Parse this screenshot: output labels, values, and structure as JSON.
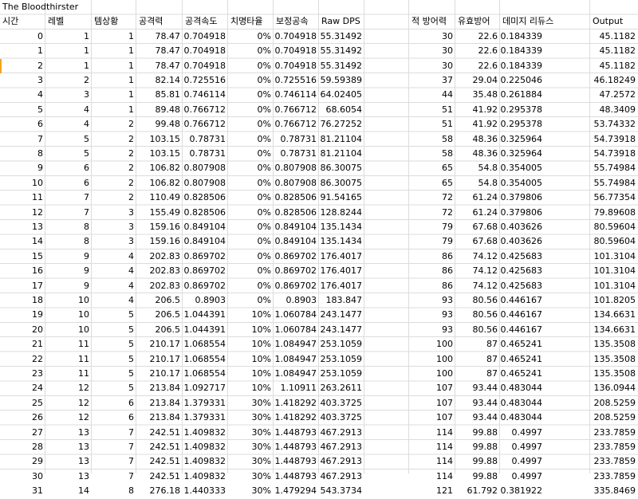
{
  "title": "The Bloodthirster",
  "headers": [
    "시간",
    "레벨",
    "템상황",
    "공격력",
    "공격속도",
    "치명타율",
    "보정공속",
    "Raw DPS",
    "",
    "적 방어력",
    "유효방어",
    "데미지 리듀스",
    "",
    "Output"
  ],
  "rows": [
    [
      "0",
      "1",
      "1",
      "78.47",
      "0.704918",
      "0%",
      "0.704918",
      "55.31492",
      "",
      "30",
      "22.6",
      "0.184339",
      "",
      "45.1182"
    ],
    [
      "1",
      "1",
      "1",
      "78.47",
      "0.704918",
      "0%",
      "0.704918",
      "55.31492",
      "",
      "30",
      "22.6",
      "0.184339",
      "",
      "45.1182"
    ],
    [
      "2",
      "1",
      "1",
      "78.47",
      "0.704918",
      "0%",
      "0.704918",
      "55.31492",
      "",
      "30",
      "22.6",
      "0.184339",
      "",
      "45.1182"
    ],
    [
      "3",
      "2",
      "1",
      "82.14",
      "0.725516",
      "0%",
      "0.725516",
      "59.59389",
      "",
      "37",
      "29.04",
      "0.225046",
      "",
      "46.18249"
    ],
    [
      "4",
      "3",
      "1",
      "85.81",
      "0.746114",
      "0%",
      "0.746114",
      "64.02405",
      "",
      "44",
      "35.48",
      "0.261884",
      "",
      "47.2572"
    ],
    [
      "5",
      "4",
      "1",
      "89.48",
      "0.766712",
      "0%",
      "0.766712",
      "68.6054",
      "",
      "51",
      "41.92",
      "0.295378",
      "",
      "48.3409"
    ],
    [
      "6",
      "4",
      "2",
      "99.48",
      "0.766712",
      "0%",
      "0.766712",
      "76.27252",
      "",
      "51",
      "41.92",
      "0.295378",
      "",
      "53.74332"
    ],
    [
      "7",
      "5",
      "2",
      "103.15",
      "0.78731",
      "0%",
      "0.78731",
      "81.21104",
      "",
      "58",
      "48.36",
      "0.325964",
      "",
      "54.73918"
    ],
    [
      "8",
      "5",
      "2",
      "103.15",
      "0.78731",
      "0%",
      "0.78731",
      "81.21104",
      "",
      "58",
      "48.36",
      "0.325964",
      "",
      "54.73918"
    ],
    [
      "9",
      "6",
      "2",
      "106.82",
      "0.807908",
      "0%",
      "0.807908",
      "86.30075",
      "",
      "65",
      "54.8",
      "0.354005",
      "",
      "55.74984"
    ],
    [
      "10",
      "6",
      "2",
      "106.82",
      "0.807908",
      "0%",
      "0.807908",
      "86.30075",
      "",
      "65",
      "54.8",
      "0.354005",
      "",
      "55.74984"
    ],
    [
      "11",
      "7",
      "2",
      "110.49",
      "0.828506",
      "0%",
      "0.828506",
      "91.54165",
      "",
      "72",
      "61.24",
      "0.379806",
      "",
      "56.77354"
    ],
    [
      "12",
      "7",
      "3",
      "155.49",
      "0.828506",
      "0%",
      "0.828506",
      "128.8244",
      "",
      "72",
      "61.24",
      "0.379806",
      "",
      "79.89608"
    ],
    [
      "13",
      "8",
      "3",
      "159.16",
      "0.849104",
      "0%",
      "0.849104",
      "135.1434",
      "",
      "79",
      "67.68",
      "0.403626",
      "",
      "80.59604"
    ],
    [
      "14",
      "8",
      "3",
      "159.16",
      "0.849104",
      "0%",
      "0.849104",
      "135.1434",
      "",
      "79",
      "67.68",
      "0.403626",
      "",
      "80.59604"
    ],
    [
      "15",
      "9",
      "4",
      "202.83",
      "0.869702",
      "0%",
      "0.869702",
      "176.4017",
      "",
      "86",
      "74.12",
      "0.425683",
      "",
      "101.3104"
    ],
    [
      "16",
      "9",
      "4",
      "202.83",
      "0.869702",
      "0%",
      "0.869702",
      "176.4017",
      "",
      "86",
      "74.12",
      "0.425683",
      "",
      "101.3104"
    ],
    [
      "17",
      "9",
      "4",
      "202.83",
      "0.869702",
      "0%",
      "0.869702",
      "176.4017",
      "",
      "86",
      "74.12",
      "0.425683",
      "",
      "101.3104"
    ],
    [
      "18",
      "10",
      "4",
      "206.5",
      "0.8903",
      "0%",
      "0.8903",
      "183.847",
      "",
      "93",
      "80.56",
      "0.446167",
      "",
      "101.8205"
    ],
    [
      "19",
      "10",
      "5",
      "206.5",
      "1.044391",
      "10%",
      "1.060784",
      "243.1477",
      "",
      "93",
      "80.56",
      "0.446167",
      "",
      "134.6631"
    ],
    [
      "20",
      "10",
      "5",
      "206.5",
      "1.044391",
      "10%",
      "1.060784",
      "243.1477",
      "",
      "93",
      "80.56",
      "0.446167",
      "",
      "134.6631"
    ],
    [
      "21",
      "11",
      "5",
      "210.17",
      "1.068554",
      "10%",
      "1.084947",
      "253.1059",
      "",
      "100",
      "87",
      "0.465241",
      "",
      "135.3508"
    ],
    [
      "22",
      "11",
      "5",
      "210.17",
      "1.068554",
      "10%",
      "1.084947",
      "253.1059",
      "",
      "100",
      "87",
      "0.465241",
      "",
      "135.3508"
    ],
    [
      "23",
      "11",
      "5",
      "210.17",
      "1.068554",
      "10%",
      "1.084947",
      "253.1059",
      "",
      "100",
      "87",
      "0.465241",
      "",
      "135.3508"
    ],
    [
      "24",
      "12",
      "5",
      "213.84",
      "1.092717",
      "10%",
      "1.10911",
      "263.2611",
      "",
      "107",
      "93.44",
      "0.483044",
      "",
      "136.0944"
    ],
    [
      "25",
      "12",
      "6",
      "213.84",
      "1.379331",
      "30%",
      "1.418292",
      "403.3725",
      "",
      "107",
      "93.44",
      "0.483044",
      "",
      "208.5259"
    ],
    [
      "26",
      "12",
      "6",
      "213.84",
      "1.379331",
      "30%",
      "1.418292",
      "403.3725",
      "",
      "107",
      "93.44",
      "0.483044",
      "",
      "208.5259"
    ],
    [
      "27",
      "13",
      "7",
      "242.51",
      "1.409832",
      "30%",
      "1.448793",
      "467.2913",
      "",
      "114",
      "99.88",
      "0.4997",
      "",
      "233.7859"
    ],
    [
      "28",
      "13",
      "7",
      "242.51",
      "1.409832",
      "30%",
      "1.448793",
      "467.2913",
      "",
      "114",
      "99.88",
      "0.4997",
      "",
      "233.7859"
    ],
    [
      "29",
      "13",
      "7",
      "242.51",
      "1.409832",
      "30%",
      "1.448793",
      "467.2913",
      "",
      "114",
      "99.88",
      "0.4997",
      "",
      "233.7859"
    ],
    [
      "30",
      "13",
      "7",
      "242.51",
      "1.409832",
      "30%",
      "1.448793",
      "467.2913",
      "",
      "114",
      "99.88",
      "0.4997",
      "",
      "233.7859"
    ],
    [
      "31",
      "14",
      "8",
      "276.18",
      "1.440333",
      "30%",
      "1.479294",
      "543.3734",
      "",
      "121",
      "61.792",
      "0.381922",
      "",
      "335.8469"
    ]
  ]
}
